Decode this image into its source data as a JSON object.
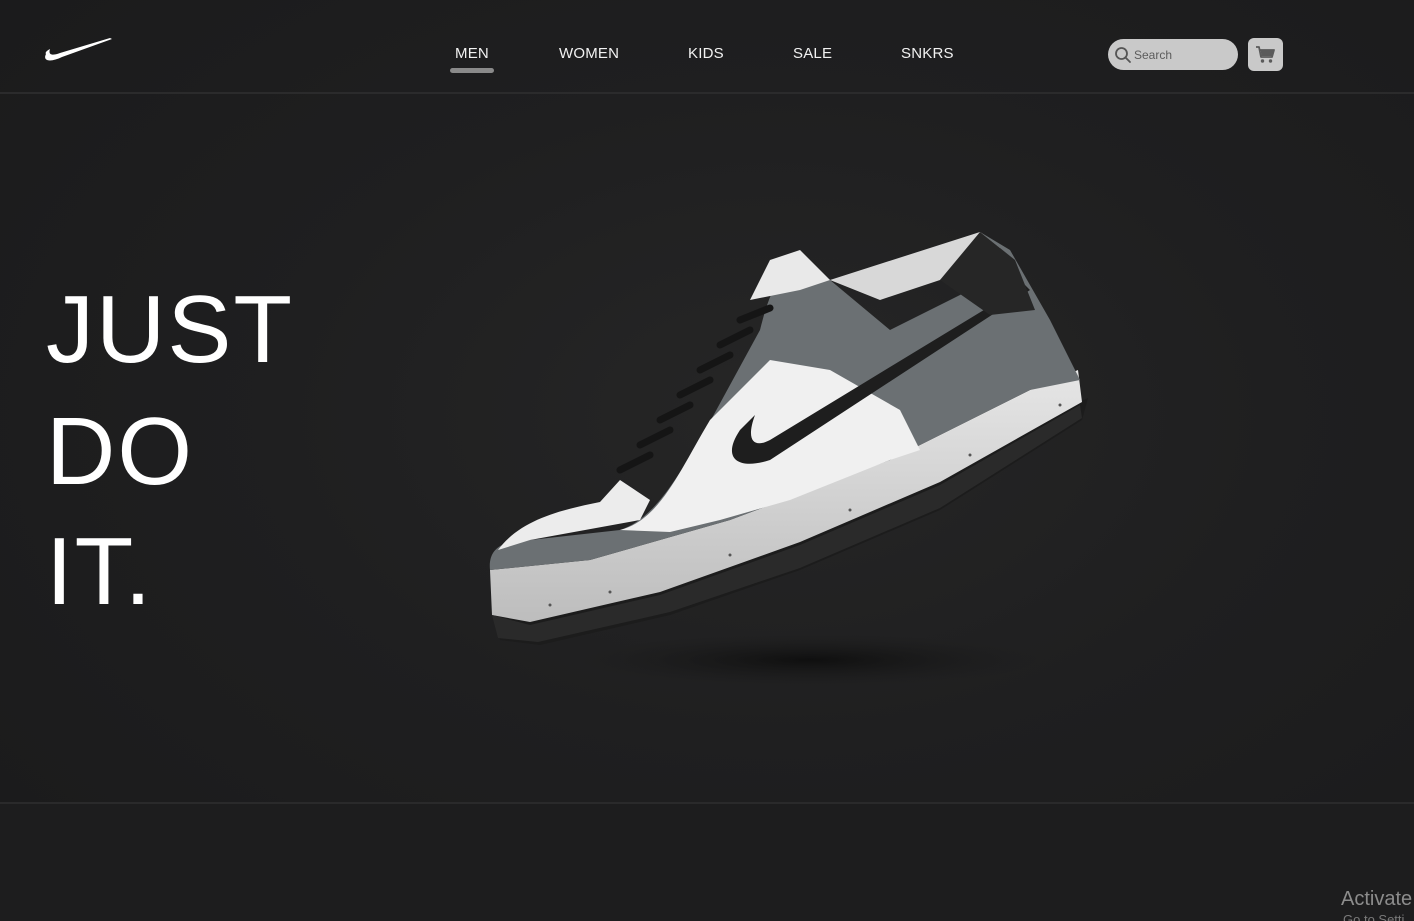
{
  "header": {
    "logo_icon": "nike-swoosh-icon",
    "nav": [
      {
        "label": "MEN",
        "active": true
      },
      {
        "label": "WOMEN",
        "active": false
      },
      {
        "label": "KIDS",
        "active": false
      },
      {
        "label": "SALE",
        "active": false
      },
      {
        "label": "SNKRS",
        "active": false
      }
    ],
    "search": {
      "placeholder": "Search",
      "value": "",
      "icon": "search-icon"
    },
    "cart": {
      "icon": "cart-icon"
    }
  },
  "hero": {
    "lines": [
      "JUST",
      "DO",
      "IT."
    ],
    "image": "sneaker-image"
  },
  "watermark": {
    "title": "Activate",
    "subtitle": "Go to Setti"
  },
  "colors": {
    "background": "#1e1e1f",
    "text": "#ffffff",
    "pill": "#c9c9c9",
    "active_underline": "#8a8a8a"
  }
}
